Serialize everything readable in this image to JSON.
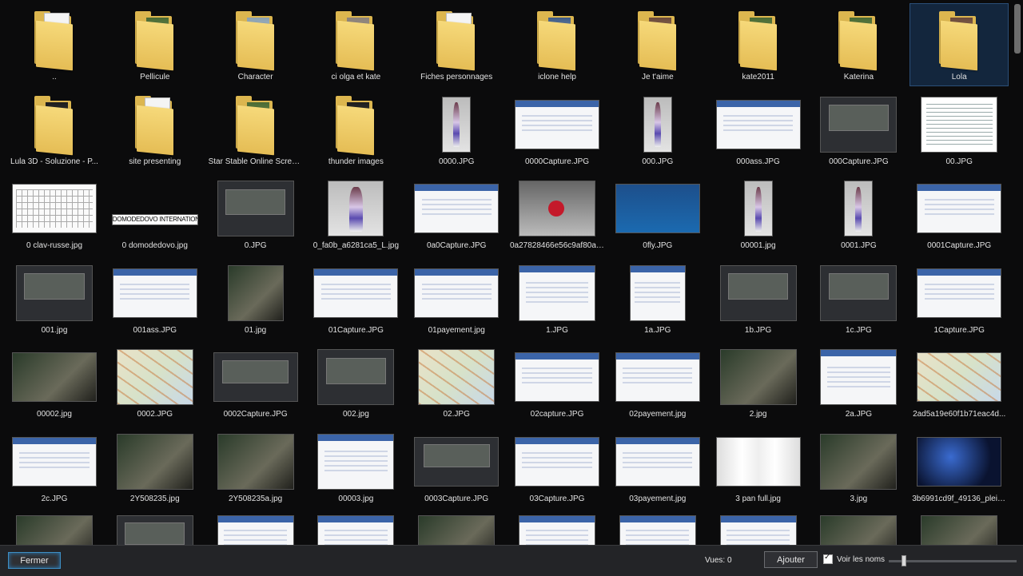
{
  "grid": {
    "items": [
      {
        "label": "..",
        "kind": "folder",
        "style": "paper"
      },
      {
        "label": "Pellicule",
        "kind": "folder",
        "style": "photo-green"
      },
      {
        "label": "Character",
        "kind": "folder",
        "style": "photo-avatar"
      },
      {
        "label": "ci olga et kate",
        "kind": "folder",
        "style": "photo-grey"
      },
      {
        "label": "Fiches personnages",
        "kind": "folder",
        "style": "paper"
      },
      {
        "label": "iclone help",
        "kind": "folder",
        "style": "photo-screen"
      },
      {
        "label": "Je t'aime",
        "kind": "folder",
        "style": "photo-warm"
      },
      {
        "label": "kate2011",
        "kind": "folder",
        "style": "photo-green"
      },
      {
        "label": "Katerina",
        "kind": "folder",
        "style": "photo-green"
      },
      {
        "label": "Lola",
        "kind": "folder",
        "style": "photo-warm",
        "selected": true
      },
      {
        "label": "Lula 3D - Soluzione - P...",
        "kind": "folder",
        "style": "photo-dark"
      },
      {
        "label": "site presenting",
        "kind": "folder",
        "style": "paper"
      },
      {
        "label": "Star Stable Online Scree...",
        "kind": "folder",
        "style": "photo-green"
      },
      {
        "label": "thunder images",
        "kind": "folder",
        "style": "photo-dark"
      },
      {
        "label": "0000.JPG",
        "kind": "image",
        "style": "avatar",
        "shape": "tall"
      },
      {
        "label": "0000Capture.JPG",
        "kind": "image",
        "style": "screen",
        "shape": "wide"
      },
      {
        "label": "000.JPG",
        "kind": "image",
        "style": "avatar",
        "shape": "tall"
      },
      {
        "label": "000ass.JPG",
        "kind": "image",
        "style": "screen",
        "shape": "wide"
      },
      {
        "label": "000Capture.JPG",
        "kind": "image",
        "style": "dark",
        "shape": "mid"
      },
      {
        "label": "00.JPG",
        "kind": "image",
        "style": "paper2",
        "shape": "mid"
      },
      {
        "label": "0 clav-russe.jpg",
        "kind": "image",
        "style": "kbd",
        "shape": "wide"
      },
      {
        "label": "0 domodedovo.jpg",
        "kind": "image",
        "style": "banner",
        "shape": "banner",
        "text": "DOMODEDOVO INTERNATIONAL AIRPORT"
      },
      {
        "label": "0.JPG",
        "kind": "image",
        "style": "dark",
        "shape": "mid"
      },
      {
        "label": "0_fa0b_a6281ca5_L.jpg",
        "kind": "image",
        "style": "avatar",
        "shape": "sq"
      },
      {
        "label": "0a0Capture.JPG",
        "kind": "image",
        "style": "screen",
        "shape": "wide"
      },
      {
        "label": "0a27828466e56c9af80a2...",
        "kind": "image",
        "style": "rose",
        "shape": "mid"
      },
      {
        "label": "0fly.JPG",
        "kind": "image",
        "style": "blue",
        "shape": "wide"
      },
      {
        "label": "00001.jpg",
        "kind": "image",
        "style": "avatar",
        "shape": "tall"
      },
      {
        "label": "0001.JPG",
        "kind": "image",
        "style": "avatar",
        "shape": "tall"
      },
      {
        "label": "0001Capture.JPG",
        "kind": "image",
        "style": "screen",
        "shape": "wide"
      },
      {
        "label": "001.jpg",
        "kind": "image",
        "style": "dark",
        "shape": "mid"
      },
      {
        "label": "001ass.JPG",
        "kind": "image",
        "style": "screen",
        "shape": "wide"
      },
      {
        "label": "01.jpg",
        "kind": "image",
        "style": "photo",
        "shape": "sq"
      },
      {
        "label": "01Capture.JPG",
        "kind": "image",
        "style": "screen",
        "shape": "wide"
      },
      {
        "label": "01payement.jpg",
        "kind": "image",
        "style": "screen",
        "shape": "wide"
      },
      {
        "label": "1.JPG",
        "kind": "image",
        "style": "screen",
        "shape": "mid"
      },
      {
        "label": "1a.JPG",
        "kind": "image",
        "style": "screen",
        "shape": "sq"
      },
      {
        "label": "1b.JPG",
        "kind": "image",
        "style": "dark",
        "shape": "mid"
      },
      {
        "label": "1c.JPG",
        "kind": "image",
        "style": "dark",
        "shape": "mid"
      },
      {
        "label": "1Capture.JPG",
        "kind": "image",
        "style": "screen",
        "shape": "wide"
      },
      {
        "label": "00002.jpg",
        "kind": "image",
        "style": "photo",
        "shape": "wide"
      },
      {
        "label": "0002.JPG",
        "kind": "image",
        "style": "map",
        "shape": "mid"
      },
      {
        "label": "0002Capture.JPG",
        "kind": "image",
        "style": "dark",
        "shape": "wide"
      },
      {
        "label": "002.jpg",
        "kind": "image",
        "style": "dark",
        "shape": "mid"
      },
      {
        "label": "02.JPG",
        "kind": "image",
        "style": "map",
        "shape": "mid"
      },
      {
        "label": "02capture.JPG",
        "kind": "image",
        "style": "screen",
        "shape": "wide"
      },
      {
        "label": "02payement.jpg",
        "kind": "image",
        "style": "screen",
        "shape": "wide"
      },
      {
        "label": "2.jpg",
        "kind": "image",
        "style": "photo",
        "shape": "mid"
      },
      {
        "label": "2a.JPG",
        "kind": "image",
        "style": "screen",
        "shape": "mid"
      },
      {
        "label": "2ad5a19e60f1b71eac4d...",
        "kind": "image",
        "style": "map",
        "shape": "wide"
      },
      {
        "label": "2c.JPG",
        "kind": "image",
        "style": "screen",
        "shape": "wide"
      },
      {
        "label": "2Y508235.jpg",
        "kind": "image",
        "style": "photo",
        "shape": "mid"
      },
      {
        "label": "2Y508235a.jpg",
        "kind": "image",
        "style": "photo",
        "shape": "mid"
      },
      {
        "label": "00003.jpg",
        "kind": "image",
        "style": "screen",
        "shape": "mid"
      },
      {
        "label": "0003Capture.JPG",
        "kind": "image",
        "style": "dark",
        "shape": "wide"
      },
      {
        "label": "03Capture.JPG",
        "kind": "image",
        "style": "screen",
        "shape": "wide"
      },
      {
        "label": "03payement.jpg",
        "kind": "image",
        "style": "screen",
        "shape": "wide"
      },
      {
        "label": "3 pan full.jpg",
        "kind": "image",
        "style": "wall",
        "shape": "wide"
      },
      {
        "label": "3.jpg",
        "kind": "image",
        "style": "photo",
        "shape": "mid"
      },
      {
        "label": "3b6991cd9f_49136_pleia...",
        "kind": "image",
        "style": "space",
        "shape": "wide"
      }
    ],
    "partial_row": [
      {
        "style": "photo"
      },
      {
        "style": "dark"
      },
      {
        "style": "screen"
      },
      {
        "style": "screen"
      },
      {
        "style": "photo"
      },
      {
        "style": "screen"
      },
      {
        "style": "screen"
      },
      {
        "style": "screen"
      },
      {
        "style": "photo"
      },
      {
        "style": "photo"
      }
    ]
  },
  "bottombar": {
    "close_label": "Fermer",
    "views_text": "Vues: 0",
    "add_label": "Ajouter",
    "show_names_label": "Voir les noms",
    "show_names_checked": true,
    "zoom_level": 0.12
  }
}
